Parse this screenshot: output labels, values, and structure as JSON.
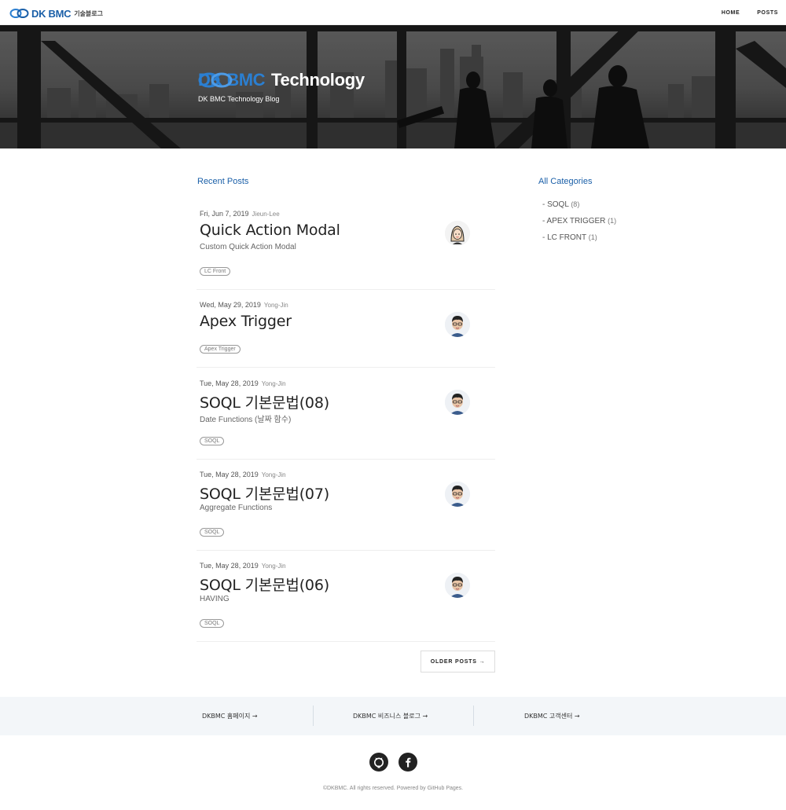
{
  "navbar": {
    "brand_name": "DK BMC",
    "brand_sub": "기술블로그",
    "links": [
      "HOME",
      "POSTS"
    ]
  },
  "hero": {
    "title_brand": "DK BMC",
    "title_rest": "Technology",
    "subtitle": "DK BMC Technology Blog"
  },
  "recent": {
    "title": "Recent Posts",
    "posts": [
      {
        "date": "Fri, Jun 7, 2019",
        "author": "Jieun-Lee",
        "title": "Quick Action Modal",
        "subtitle": "Custom Quick Action Modal",
        "tag": "LC Front",
        "avatar": "female-avatar-icon"
      },
      {
        "date": "Wed, May 29, 2019",
        "author": "Yong-Jin",
        "title": "Apex Trigger",
        "subtitle": "",
        "tag": "Apex Trigger",
        "avatar": "male-avatar-icon"
      },
      {
        "date": "Tue, May 28, 2019",
        "author": "Yong-Jin",
        "title": "SOQL 기본문법(08)",
        "subtitle": "Date Functions (날짜 함수)",
        "tag": "SOQL",
        "avatar": "male-avatar-icon"
      },
      {
        "date": "Tue, May 28, 2019",
        "author": "Yong-Jin",
        "title": "SOQL 기본문법(07)",
        "subtitle": "Aggregate Functions",
        "tag": "SOQL",
        "avatar": "male-avatar-icon"
      },
      {
        "date": "Tue, May 28, 2019",
        "author": "Yong-Jin",
        "title": "SOQL 기본문법(06)",
        "subtitle": "HAVING",
        "tag": "SOQL",
        "avatar": "male-avatar-icon"
      }
    ],
    "older_label": "OLDER POSTS →"
  },
  "categories": {
    "title": "All Categories",
    "items": [
      {
        "label": "- SOQL",
        "count": "(8)"
      },
      {
        "label": "- APEX TRIGGER",
        "count": "(1)"
      },
      {
        "label": "- LC FRONT",
        "count": "(1)"
      }
    ]
  },
  "footer": {
    "links": [
      "DKBMC 홈페이지 →",
      "DKBMC 비즈니스 블로그 →",
      "DKBMC 고객센터 →"
    ],
    "social": [
      "github-icon",
      "facebook-icon"
    ],
    "copyright": "©DKBMC. All rights reserved. Powered by GitHub Pages."
  },
  "colors": {
    "accent": "#1a5fa8",
    "footer_bg": "#f3f6f9"
  }
}
